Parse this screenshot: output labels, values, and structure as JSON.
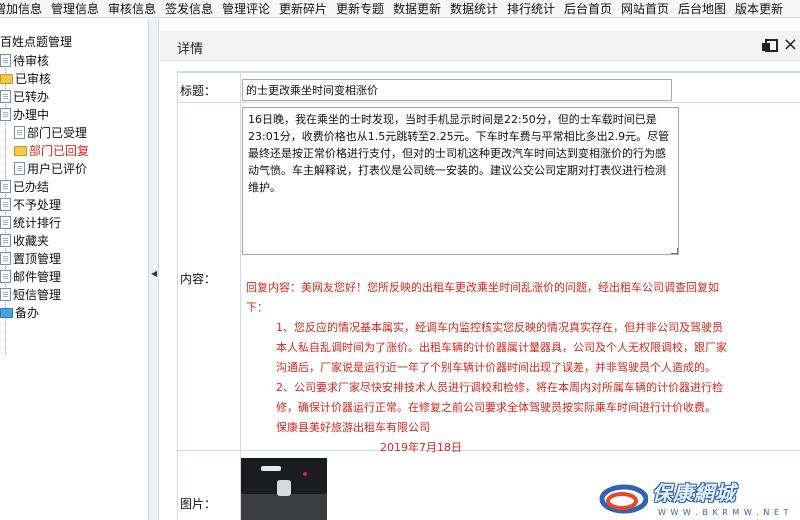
{
  "topbar": {
    "items": [
      "增加信息",
      "管理信息",
      "审核信息",
      "签发信息",
      "管理评论",
      "更新碎片",
      "更新专题",
      "数据更新",
      "数据统计",
      "排行统计",
      "后台首页",
      "网站首页",
      "后台地图",
      "版本更新"
    ]
  },
  "sidebar": {
    "root": "百姓点题管理",
    "items": [
      {
        "label": "待审核",
        "icon": "doc-icon"
      },
      {
        "label": "已审核",
        "icon": "folder-icon"
      },
      {
        "label": "已转办",
        "icon": "doc-icon"
      },
      {
        "label": "办理中",
        "icon": "doc-icon"
      },
      {
        "label": "部门已受理",
        "icon": "doc-icon"
      },
      {
        "label": "部门已回复",
        "icon": "folder-icon"
      },
      {
        "label": "用户已评价",
        "icon": "doc-icon"
      },
      {
        "label": "已办结",
        "icon": "doc-icon"
      },
      {
        "label": "不予处理",
        "icon": "doc-icon"
      },
      {
        "label": "统计排行",
        "icon": "doc-icon"
      },
      {
        "label": "收藏夹",
        "icon": "doc-icon"
      },
      {
        "label": "置顶管理",
        "icon": "doc-icon"
      },
      {
        "label": "邮件管理",
        "icon": "doc-icon"
      },
      {
        "label": "短信管理",
        "icon": "doc-icon"
      },
      {
        "label": "备办",
        "icon": "folder-blue-icon"
      }
    ],
    "active_color": "#d6281e"
  },
  "splitter": {
    "arrow": "◀"
  },
  "panel": {
    "title": "详情",
    "close_glyph": "×",
    "fields": {
      "title_label": "标题：",
      "title_value": "的士更改乘坐时间变相涨价",
      "content_label": "内容：",
      "content_value": "16日晚，我在乘坐的士时发现，当时手机显示时间是22:50分，但的士车载时间已是23:01分，收费价格也从1.5元跳转至2.25元。下车时车费与平常相比多出2.9元。尽管最终还是按正常价格进行支付，但对的士司机这种更改汽车时间达到变相涨价的行为感动气愤。车主解释说，打表仪是公司统一安装的。建议公交公司定期对打表仪进行检测维护。",
      "reply_line1": "回复内容：美网友您好！您所反映的出租车更改乘坐时间乱涨价的问题，经出租车公司调查回复如下：",
      "reply_line2": "1、您反应的情况基本属实，经调车内监控核实您反映的情况真实存在，但并非公司及驾驶员本人私自乱调时间为了涨价。出租车辆的计价器属计量器具，公司及个人无权限调校，跟厂家沟通后，厂家说是运行近一年了个别车辆计价器时间出现了误差，并非驾驶员个人造成的。 2、公司要求厂家尽快安排技术人员进行调校和检修，将在本周内对所属车辆的计价器进行检修，确保计价器运行正常。在修复之前公司要求全体驾驶员按实际乘车时间进行计价收费。 保康县美好旅游出租车有限公司",
      "reply_date": "2019年7月18日",
      "image_label": "图片："
    }
  },
  "logo": {
    "brand": "保康網城",
    "site": "W W W . B K R M W . N E T"
  }
}
